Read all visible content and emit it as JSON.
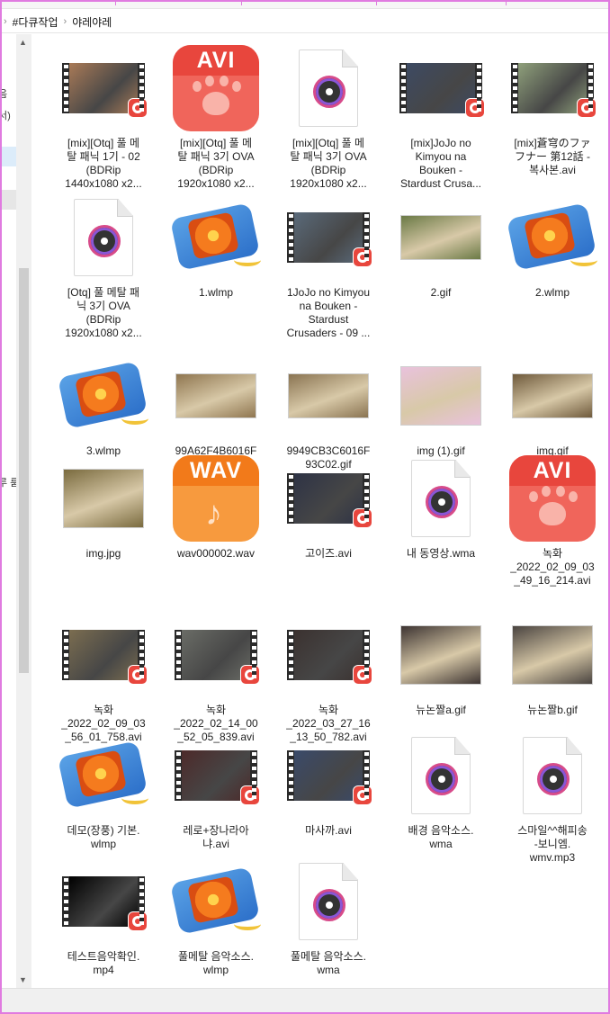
{
  "address": {
    "segments": [
      "#다큐작업",
      "야레야레"
    ]
  },
  "leftpane": {
    "snips": [
      "음",
      "서)",
      "루 룸"
    ]
  },
  "files": [
    {
      "type": "video",
      "label": "[mix][Otq] 풀 메\n탈 패닉 1기 - 02\n(BDRip\n1440x1080 x2...",
      "color": "#a97a57"
    },
    {
      "type": "avi",
      "label": "[mix][Otq] 풀 메\n탈 패닉 3기 OVA\n(BDRip\n1920x1080 x2..."
    },
    {
      "type": "doc",
      "label": "[mix][Otq] 풀 메\n탈 패닉 3기 OVA\n(BDRip\n1920x1080 x2..."
    },
    {
      "type": "video",
      "label": "[mix]JoJo no\nKimyou na\nBouken -\nStardust Crusa...",
      "color": "#3d4a63"
    },
    {
      "type": "video",
      "label": "[mix]蒼穹のファ\nフナー 第12話 -\n복사본.avi",
      "color": "#8fa07b"
    },
    {
      "type": "doc",
      "label": "[Otq] 풀 메탈 패\n닉 3기 OVA\n(BDRip\n1920x1080 x2..."
    },
    {
      "type": "wlmp",
      "label": "1.wlmp"
    },
    {
      "type": "video",
      "label": "1JoJo no Kimyou\nna Bouken -\nStardust\nCrusaders - 09 ...",
      "color": "#5a6a7a"
    },
    {
      "type": "photo",
      "label": "2.gif",
      "color": "#6b7a46"
    },
    {
      "type": "wlmp",
      "label": "2.wlmp"
    },
    {
      "type": "wlmp",
      "label": "3.wlmp"
    },
    {
      "type": "photo",
      "label": "99A62F4B6016F\n7CB02.gif",
      "color": "#8f7650"
    },
    {
      "type": "photo",
      "label": "9949CB3C6016F\n93C02.gif",
      "color": "#8a7452"
    },
    {
      "type": "photo",
      "label": "img (1).gif",
      "color": "#e9c2dc"
    },
    {
      "type": "photo",
      "label": "img.gif",
      "color": "#6f5a3c"
    },
    {
      "type": "photo",
      "label": "img.jpg",
      "color": "#7a6b3f"
    },
    {
      "type": "wav",
      "label": "wav000002.wav"
    },
    {
      "type": "video",
      "label": "고이즈.avi",
      "color": "#2e3345"
    },
    {
      "type": "doc",
      "label": "내 동영상.wma"
    },
    {
      "type": "avi",
      "label": "녹화\n_2022_02_09_03\n_49_16_214.avi"
    },
    {
      "type": "video",
      "label": "녹화\n_2022_02_09_03\n_56_01_758.avi",
      "color": "#7b6d50"
    },
    {
      "type": "video",
      "label": "녹화\n_2022_02_14_00\n_52_05_839.avi",
      "color": "#6a6c66"
    },
    {
      "type": "video",
      "label": "녹화\n_2022_03_27_16\n_13_50_782.avi",
      "color": "#3b3230"
    },
    {
      "type": "photo",
      "label": "뉴논짤a.gif",
      "color": "#3d3432"
    },
    {
      "type": "photo",
      "label": "뉴논짤b.gif",
      "color": "#4a4440"
    },
    {
      "type": "wlmp",
      "label": "데모(장풍) 기본.\nwlmp"
    },
    {
      "type": "video",
      "label": "레로+장나라아\n냐.avi",
      "color": "#4d2a2a"
    },
    {
      "type": "video",
      "label": "마사까.avi",
      "color": "#3a4a6a"
    },
    {
      "type": "doc",
      "label": "배경 음악소스.\nwma"
    },
    {
      "type": "doc",
      "label": "스마일^^해피송\n-보니엠.\nwmv.mp3"
    },
    {
      "type": "video",
      "label": "테스트음악확인.\nmp4",
      "color": "#000000"
    },
    {
      "type": "wlmp",
      "label": "풀메탈 음악소스.\nwlmp"
    },
    {
      "type": "doc",
      "label": "풀메탈 음악소스.\nwma"
    }
  ],
  "colors": {
    "avi_red": "#e8463d",
    "avi_body": "#f0655b",
    "wav_orange": "#f27a1a",
    "wav_body": "#f79a3e",
    "frame_pink": "#e07be0"
  }
}
